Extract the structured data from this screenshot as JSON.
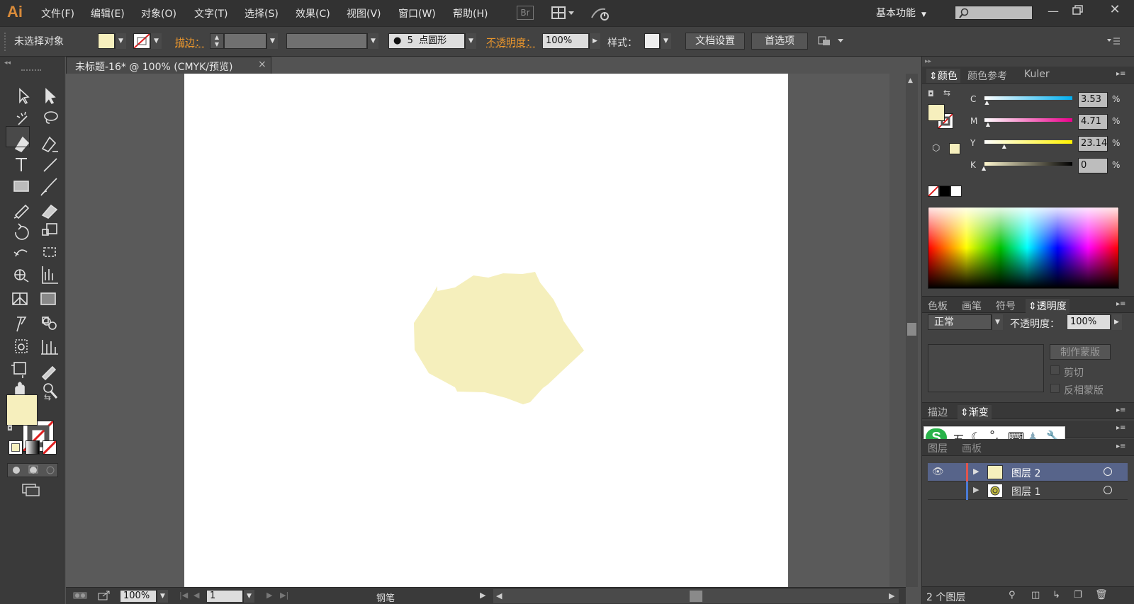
{
  "app": {
    "logo": "Ai",
    "workspace": "基本功能",
    "search_placeholder": ""
  },
  "menu": [
    "文件(F)",
    "编辑(E)",
    "对象(O)",
    "文字(T)",
    "选择(S)",
    "效果(C)",
    "视图(V)",
    "窗口(W)",
    "帮助(H)"
  ],
  "menu_badge": "Br",
  "control": {
    "selection": "未选择对象",
    "stroke_label": "描边：",
    "brush_size": "5",
    "brush_shape": "点圆形",
    "opacity_label": "不透明度：",
    "opacity_value": "100%",
    "style_label": "样式：",
    "doc_setup": "文档设置",
    "prefs": "首选项"
  },
  "doc": {
    "tab_title": "未标题-16* @ 100% (CMYK/预览)",
    "close": "×"
  },
  "status": {
    "zoom": "100%",
    "page": "1",
    "tool": "钢笔"
  },
  "colors": {
    "fill": "#f6efbd",
    "shape": "#f5efbc",
    "accent": "#e8952d"
  },
  "color_panel": {
    "tabs": [
      "颜色",
      "颜色参考",
      "Kuler"
    ],
    "channels": [
      {
        "label": "C",
        "value": "3.53",
        "pct": "%"
      },
      {
        "label": "M",
        "value": "4.71",
        "pct": "%"
      },
      {
        "label": "Y",
        "value": "23.14",
        "pct": "%"
      },
      {
        "label": "K",
        "value": "0",
        "pct": "%"
      }
    ]
  },
  "transp_panel": {
    "tabs": [
      "色板",
      "画笔",
      "符号",
      "透明度"
    ],
    "blend": "正常",
    "opacity_label": "不透明度：",
    "opacity_value": "100%",
    "make_mask": "制作蒙版",
    "clip": "剪切",
    "invert": "反相蒙版"
  },
  "stroke_panel": {
    "tabs": [
      "描边",
      "渐变"
    ]
  },
  "ime": {
    "label": "五"
  },
  "layers_panel": {
    "tabs": [
      "图层",
      "画板"
    ],
    "layers": [
      {
        "name": "图层 2",
        "color": "#e0554d"
      },
      {
        "name": "图层 1",
        "color": "#4a7bd6"
      }
    ],
    "count": "2 个图层"
  }
}
